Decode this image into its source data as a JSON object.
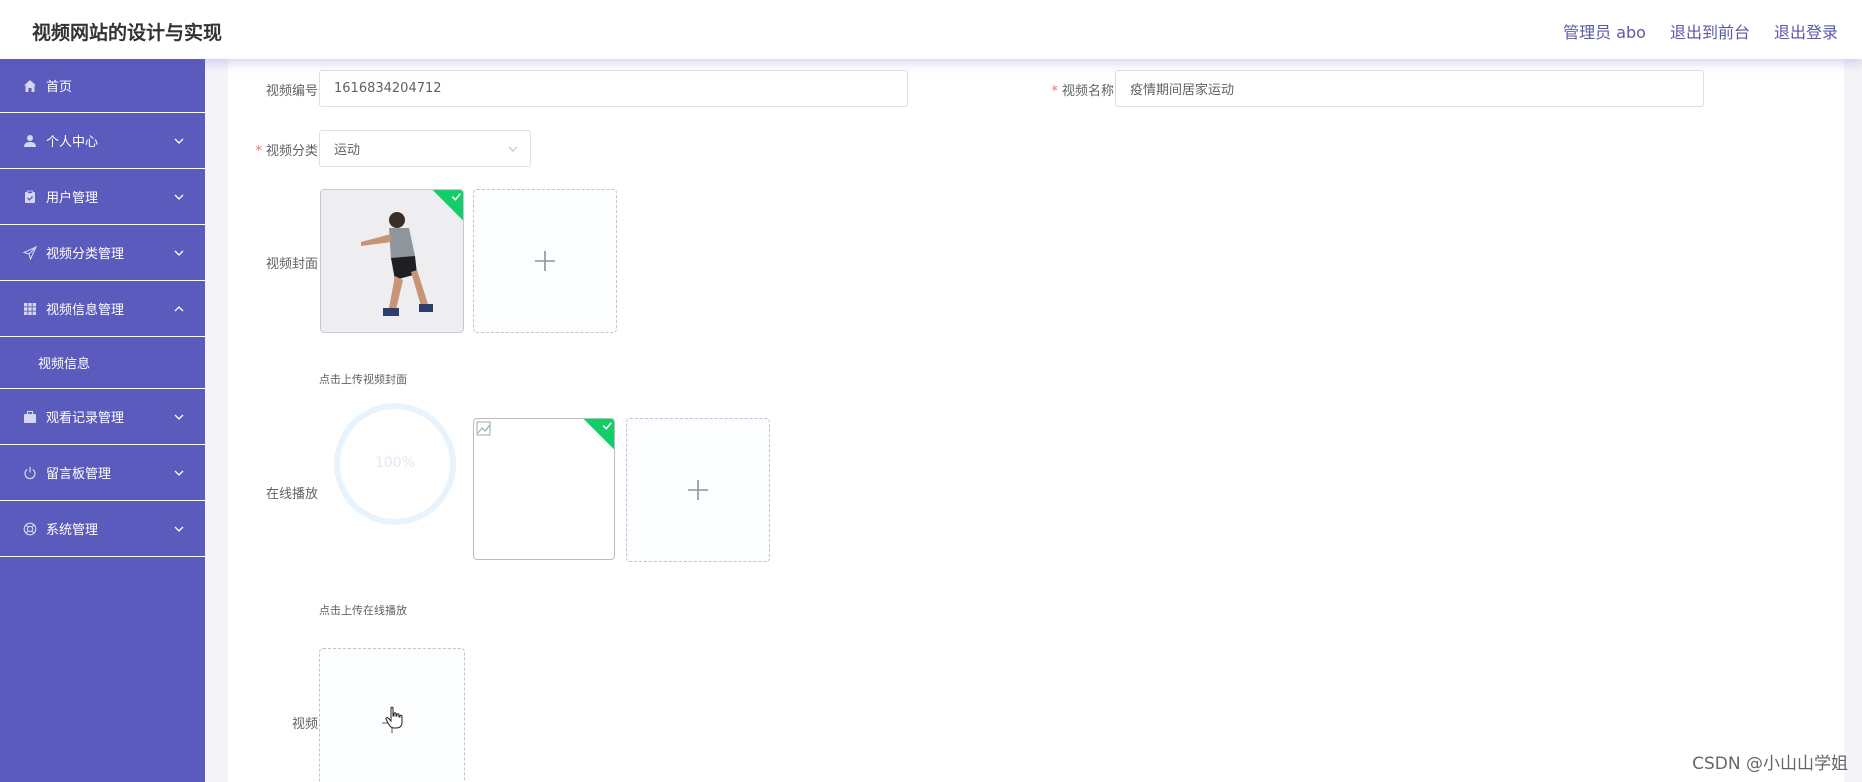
{
  "header": {
    "title": "视频网站的设计与实现",
    "admin": "管理员 abo",
    "back_front": "退出到前台",
    "logout": "退出登录"
  },
  "sidebar": {
    "items": [
      {
        "label": "首页",
        "icon": "home-icon"
      },
      {
        "label": "个人中心",
        "icon": "user-icon"
      },
      {
        "label": "用户管理",
        "icon": "clipboard-icon"
      },
      {
        "label": "视频分类管理",
        "icon": "send-icon"
      },
      {
        "label": "视频信息管理",
        "icon": "grid-icon",
        "expanded": true
      },
      {
        "label": "视频信息",
        "sub": true
      },
      {
        "label": "观看记录管理",
        "icon": "briefcase-icon"
      },
      {
        "label": "留言板管理",
        "icon": "power-icon"
      },
      {
        "label": "系统管理",
        "icon": "help-ring-icon"
      }
    ]
  },
  "form": {
    "video_no_label": "视频编号",
    "video_no_value": "1616834204712",
    "video_name_label": "视频名称",
    "video_name_value": "疫情期间居家运动",
    "category_label": "视频分类",
    "category_value": "运动",
    "cover_label": "视频封面",
    "cover_tip": "点击上传视频封面",
    "play_label": "在线播放",
    "play_progress_text": "100%",
    "play_tip": "点击上传在线播放",
    "video_label": "视频"
  },
  "colors": {
    "sidebar_bg": "#5b5bbd",
    "success": "#13ce66",
    "required": "#f56c6c",
    "header_link": "#5a5aa8"
  },
  "watermark": "CSDN @小山山学姐"
}
